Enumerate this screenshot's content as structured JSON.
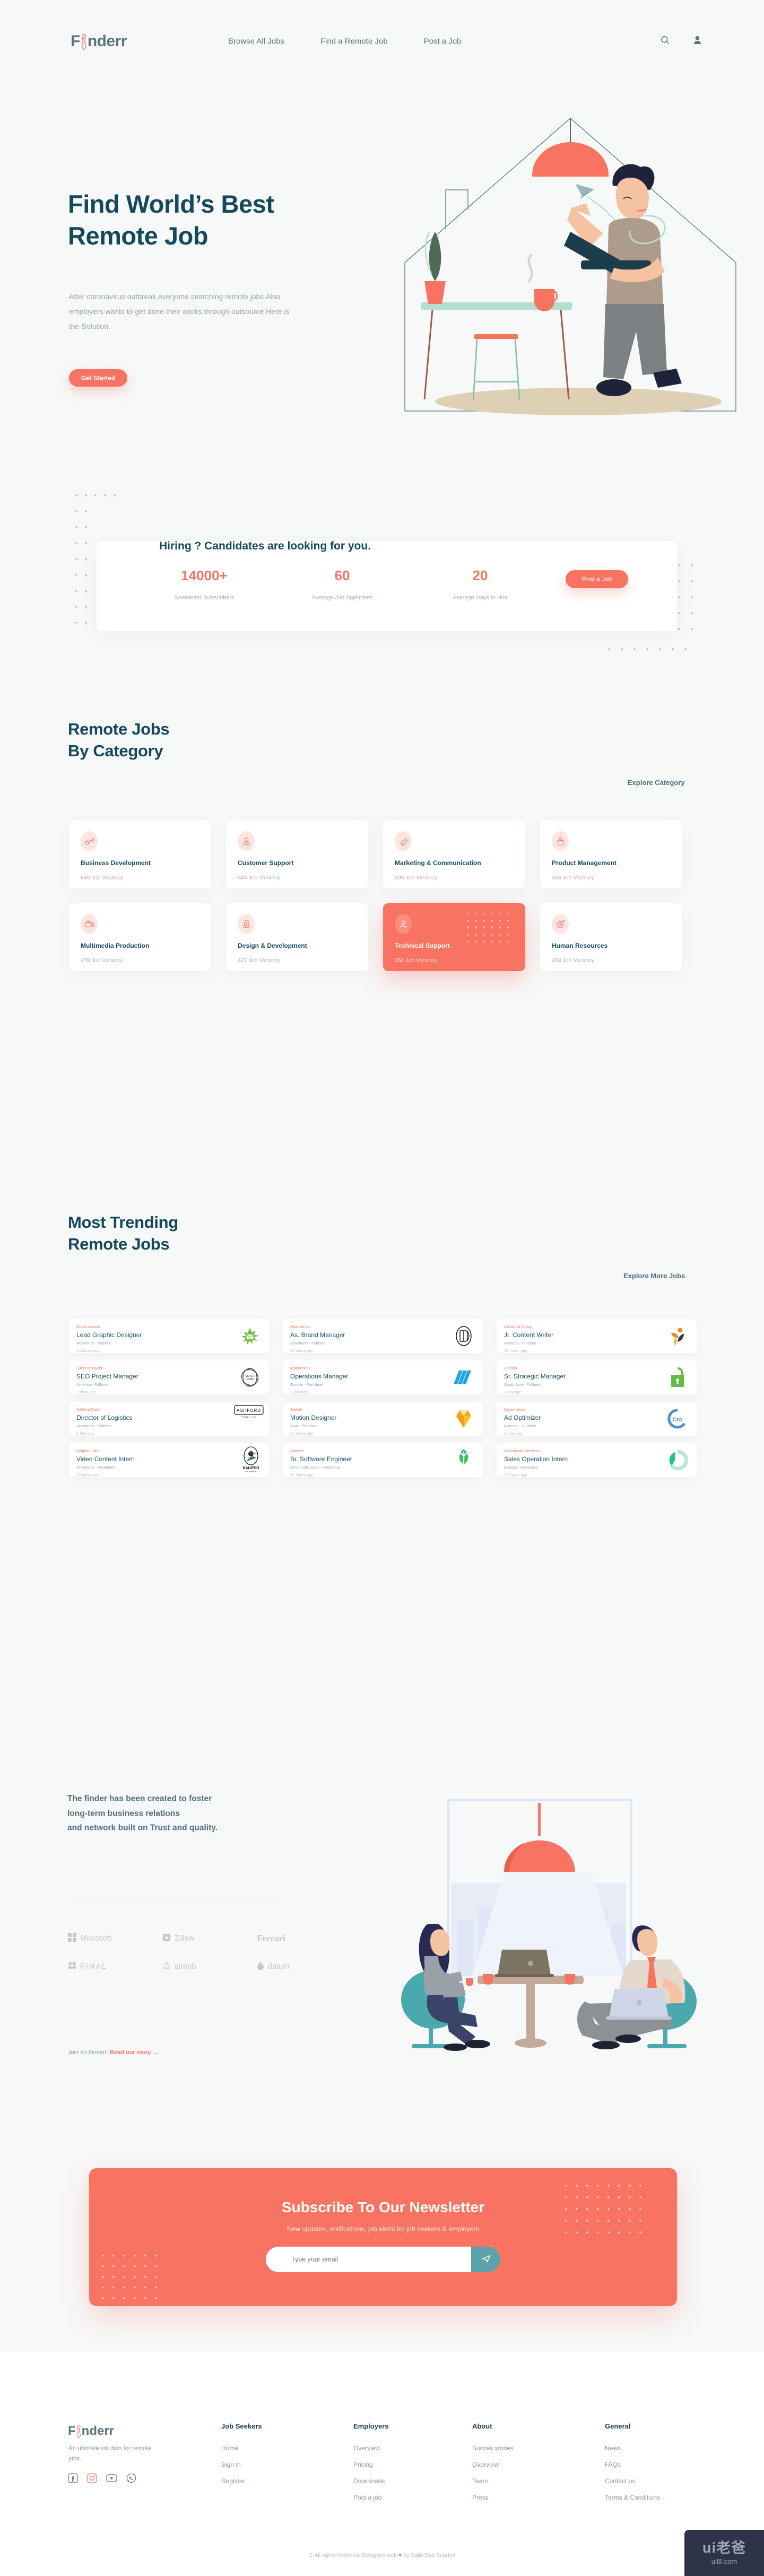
{
  "brand": {
    "name_pre": "F",
    "name_post": "nderr",
    "accent": "#f97362",
    "dark": "#15485d"
  },
  "nav": {
    "links": [
      {
        "label": "Browse All Jobs"
      },
      {
        "label": "Find a Remote Job"
      },
      {
        "label": "Post a Job"
      }
    ],
    "search_icon": "search-icon",
    "account_icon": "user-icon"
  },
  "hero": {
    "title_line1": "Find World’s Best",
    "title_line2": "Remote Job",
    "paragraph": "After coronavirus outbreak everyone searching remote jobs.Also employers wants to get done their works through outsource.Here is the Solution.",
    "cta": "Get Started"
  },
  "hiring": {
    "title": "Hiring ? Candidates are looking for you.",
    "cta": "Post a Job",
    "stats": [
      {
        "value": "14000+",
        "label": "Newsletter Subscribers"
      },
      {
        "value": "60",
        "label": "Average Job Applicants"
      },
      {
        "value": "20",
        "label": "Average Days to Hire"
      }
    ]
  },
  "categories_section": {
    "title_line1": "Remote Jobs",
    "title_line2": "By Category",
    "link": "Explore Category",
    "items": [
      {
        "name": "Business Development",
        "vacancy": "649 Job Vacancy",
        "icon": "growth-chart-icon",
        "active": false
      },
      {
        "name": "Customer Support",
        "vacancy": "345 Job Vacancy",
        "icon": "headset-person-icon",
        "active": false
      },
      {
        "name": "Marketing & Communication",
        "vacancy": "296 Job Vacancy",
        "icon": "megaphone-icon",
        "active": false
      },
      {
        "name": "Product Management",
        "vacancy": "356 Job Vacancy",
        "icon": "product-box-icon",
        "active": false
      },
      {
        "name": "Multimedia Production",
        "vacancy": "478 Job Vacancy",
        "icon": "film-camera-icon",
        "active": false
      },
      {
        "name": "Design & Development",
        "vacancy": "427 Job Vacancy",
        "icon": "pen-tools-icon",
        "active": false
      },
      {
        "name": "Technical Support",
        "vacancy": "354 Job Vacancy",
        "icon": "gear-hand-icon",
        "active": true
      },
      {
        "name": "Human Resources",
        "vacancy": "458 Job Vacancy",
        "icon": "target-dart-icon",
        "active": false
      }
    ]
  },
  "jobs_section": {
    "title_line1": "Most Trending",
    "title_line2": "Remote Jobs",
    "link": "Explore More Jobs",
    "items": [
      {
        "company": "Email on acid",
        "title": "Lead Graphic Designer",
        "meta": "Anywhere - Fulltime",
        "time": "14 hours ago",
        "logo": "splash-green-logo"
      },
      {
        "company": "Optimal Ltd",
        "title": "As. Brand Manager",
        "meta": "Anywhere - Fulltime",
        "time": "20 hours ago",
        "logo": "oval-monogram-logo"
      },
      {
        "company": "Crowford Group",
        "title": "Jr. Content Writer",
        "meta": "America - Fulltime",
        "time": "16 hours ago",
        "logo": "orange-figure-logo"
      },
      {
        "company": "Silver lining ltd",
        "title": "SEO Project Manager",
        "meta": "America - Fulltime",
        "time": "2 days ago",
        "logo": "silver-lining-logo"
      },
      {
        "company": "ManyPixels",
        "title": "Operations Manager",
        "meta": "Europe - Part time",
        "time": "1 day ago",
        "logo": "blue-slashes-logo"
      },
      {
        "company": "Finfolio",
        "title": "Sr. Strategic Manager",
        "meta": "South Asia - Fulltime",
        "time": "1 day ago",
        "logo": "green-lock-logo"
      },
      {
        "company": "Ashford Point",
        "title": "Director of Logistics",
        "meta": "Anywhere - Fulltime",
        "time": "1 day ago",
        "logo": "ashford-point-logo"
      },
      {
        "company": "Sketch",
        "title": "Motion Designer",
        "meta": "Asia - Part time",
        "time": "20 hours ago",
        "logo": "sketch-diamond-logo"
      },
      {
        "company": "Crowmetics",
        "title": "Ad Optimizer",
        "meta": "America - Fulltime",
        "time": "2 days ago",
        "logo": "cro-circle-logo"
      },
      {
        "company": "Kalipso Labs",
        "title": "Video Content Intern",
        "meta": "Anywhere - Freelance",
        "time": "14 hours ago",
        "logo": "kalipso-toucan-logo"
      },
      {
        "company": "Amitree",
        "title": "Sr. Software Engineer",
        "meta": "America/Europe - Freelance",
        "time": "12 hours ago",
        "logo": "green-leaf-logo"
      },
      {
        "company": "Greenback Services",
        "title": "Sales Operation Intern",
        "meta": "Europe - Freelance",
        "time": "23 hours ago",
        "logo": "green-donut-logo"
      }
    ]
  },
  "trust": {
    "line1": "The finder has been created to foster",
    "line2": "long-term business relations",
    "line3": "and network built on Trust and quality.",
    "brands": [
      {
        "name": "Microsoft",
        "icon": "microsoft-squares-icon"
      },
      {
        "name": "Zillow",
        "icon": "zillow-house-icon"
      },
      {
        "name": "Ferrari",
        "icon": "ferrari-wordmark-icon"
      },
      {
        "name": "FINAL",
        "icon": "final-clover-icon"
      },
      {
        "name": "airbnb",
        "icon": "airbnb-bello-icon"
      },
      {
        "name": "datum",
        "icon": "datum-drop-icon"
      }
    ],
    "join_prefix": "Join on Finderr.",
    "join_link": "Read our story →"
  },
  "newsletter": {
    "title": "Subscribe To Our Newsletter",
    "subtitle": "New updates, notifications, job alerts for job seekers & employers",
    "placeholder": "Type your email",
    "value": "",
    "submit_icon": "send-icon"
  },
  "footer": {
    "tagline": "An ultimate solution for remote jobs.",
    "socials": [
      {
        "name": "facebook-icon"
      },
      {
        "name": "instagram-icon"
      },
      {
        "name": "youtube-icon"
      },
      {
        "name": "whatsapp-icon"
      }
    ],
    "columns": [
      {
        "heading": "Job Seekers",
        "links": [
          "Home",
          "Sign in",
          "Register"
        ]
      },
      {
        "heading": "Employers",
        "links": [
          "Overview",
          "Pricing",
          "Downloads",
          "Post a job"
        ]
      },
      {
        "heading": "About",
        "links": [
          "Succes stories",
          "Overview",
          "Team",
          "Press"
        ]
      },
      {
        "heading": "General",
        "links": [
          "News",
          "FAQs",
          "Contact us",
          "Terms & Conditions"
        ]
      }
    ],
    "copyright_pre": "©  All rights reserved. Designed with ",
    "copyright_heart": "♥",
    "copyright_post": " by Sajib Das Supriyo"
  },
  "watermark": {
    "line1": "ui老爸",
    "line2": "uil8.com"
  }
}
